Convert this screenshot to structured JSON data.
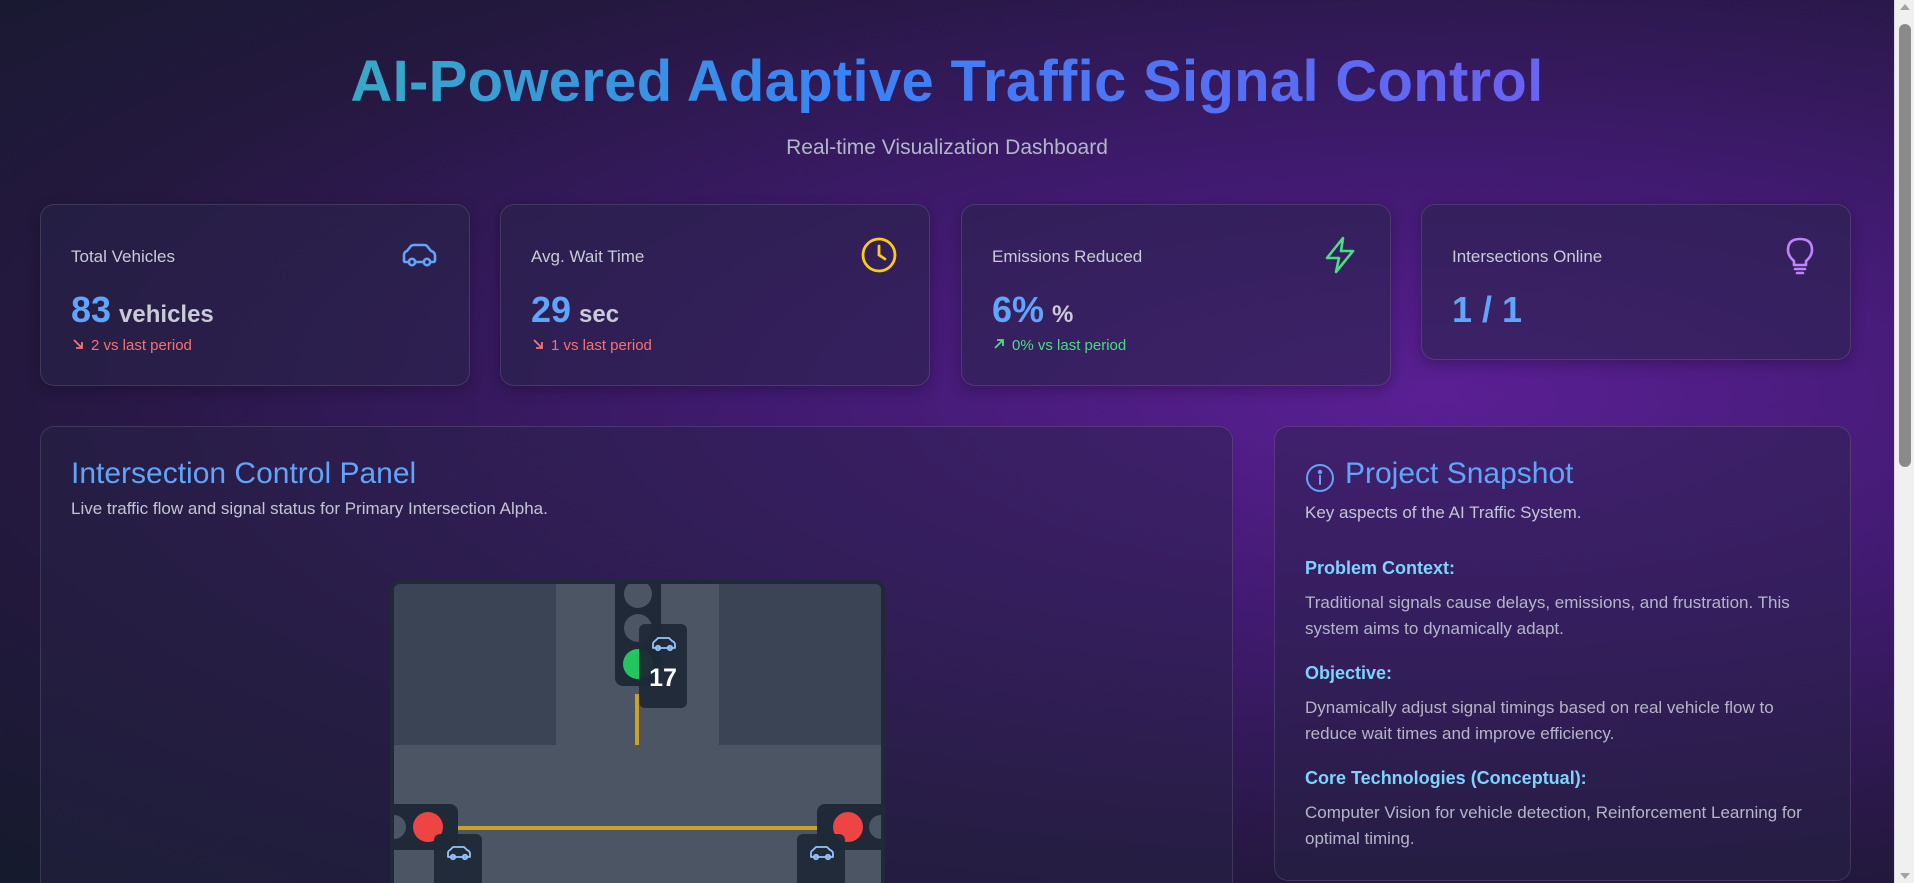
{
  "header": {
    "title": "AI-Powered Adaptive Traffic Signal Control",
    "subtitle": "Real-time Visualization Dashboard"
  },
  "stats": [
    {
      "title": "Total Vehicles",
      "value": "83",
      "unit": "vehicles",
      "trend": "2 vs last period",
      "trend_dir": "down",
      "icon": "car-icon",
      "icon_color": "#60a5fa"
    },
    {
      "title": "Avg. Wait Time",
      "value": "29",
      "unit": "sec",
      "trend": "1 vs last period",
      "trend_dir": "down",
      "icon": "clock-icon",
      "icon_color": "#facc15"
    },
    {
      "title": "Emissions Reduced",
      "value": "6%",
      "unit": "%",
      "trend": "0% vs last period",
      "trend_dir": "up",
      "icon": "lightning-icon",
      "icon_color": "#4ade80"
    },
    {
      "title": "Intersections Online",
      "value": "1 / 1",
      "unit": "",
      "trend": "",
      "icon": "lightbulb-icon",
      "icon_color": "#c084fc"
    }
  ],
  "control_panel": {
    "title": "Intersection Control Panel",
    "description": "Live traffic flow and signal status for Primary Intersection Alpha.",
    "north_count": "17",
    "signals": {
      "north": "green",
      "west": "red",
      "east": "red"
    }
  },
  "snapshot": {
    "title": "Project Snapshot",
    "description": "Key aspects of the AI Traffic System.",
    "sections": [
      {
        "title": "Problem Context:",
        "text": "Traditional signals cause delays, emissions, and frustration. This system aims to dynamically adapt."
      },
      {
        "title": "Objective:",
        "text": "Dynamically adjust signal timings based on real vehicle flow to reduce wait times and improve efficiency."
      },
      {
        "title": "Core Technologies (Conceptual):",
        "text": "Computer Vision for vehicle detection, Reinforcement Learning for optimal timing."
      }
    ]
  },
  "colors": {
    "accent_blue": "#60a5fa",
    "trend_down": "#f87171",
    "trend_up": "#4ade80",
    "section_title": "#7dd3fc",
    "signal_green": "#22c55e",
    "signal_red": "#ef4444"
  }
}
